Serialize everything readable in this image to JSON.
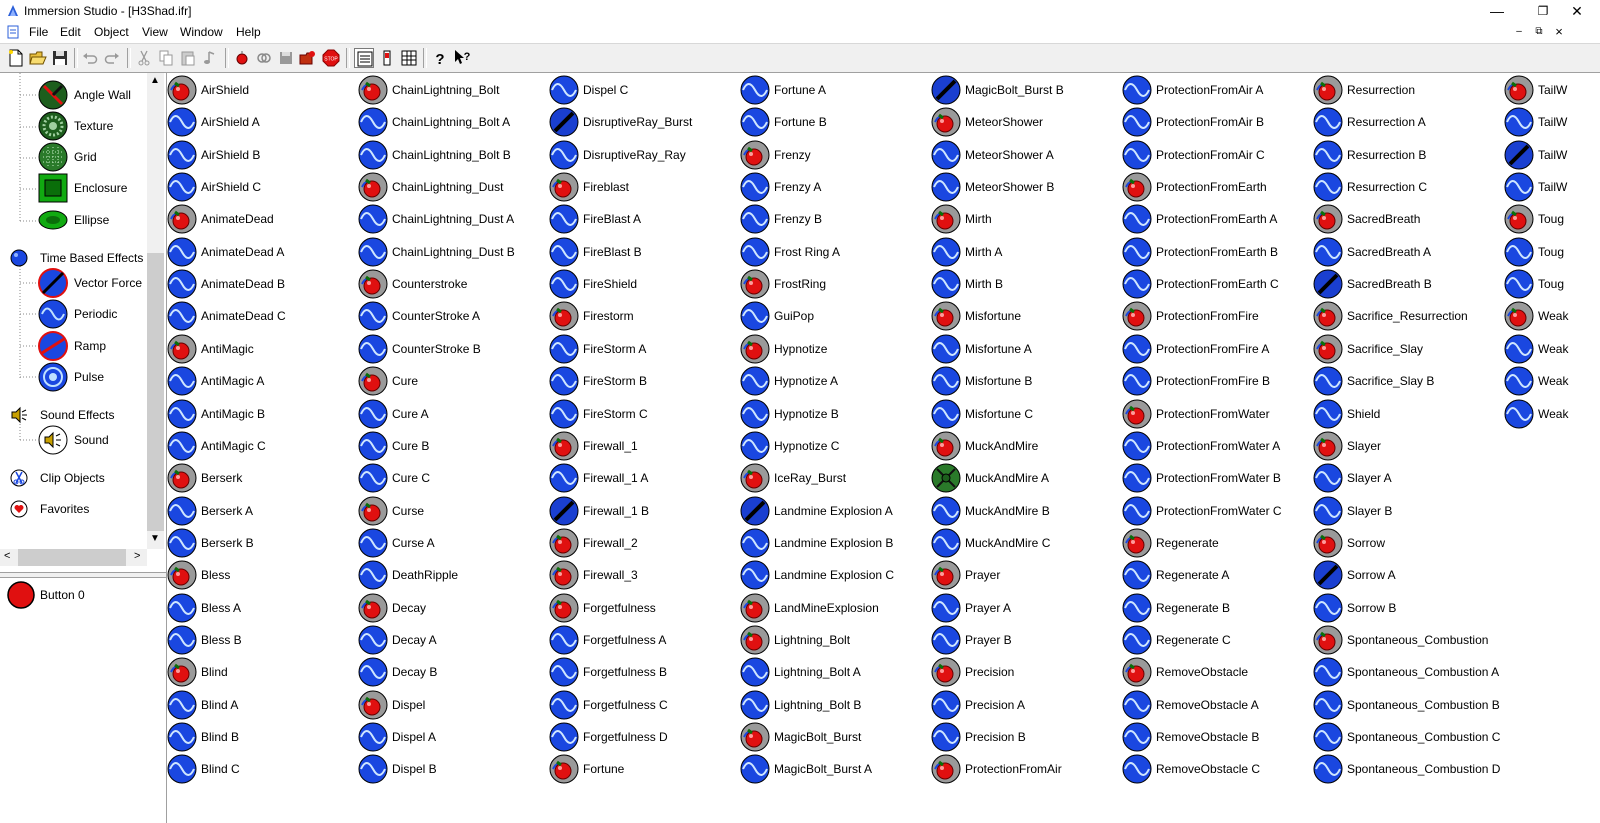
{
  "window": {
    "title": "Immersion Studio - [H3Shad.ifr]",
    "controls": {
      "minimize": "—",
      "restore": "❐",
      "close": "✕"
    }
  },
  "menu": [
    "File",
    "Edit",
    "Object",
    "View",
    "Window",
    "Help"
  ],
  "mdi_controls": {
    "minimize": "–",
    "restore": "⧉",
    "close": "×"
  },
  "toolbar": {
    "buttons": [
      "new",
      "open",
      "save",
      "undo",
      "redo",
      "cut",
      "copy",
      "paste",
      "play-sound",
      "record",
      "link",
      "disk",
      "open-folder",
      "stop",
      "view-list",
      "view-details",
      "view-icons",
      "help",
      "context-help"
    ]
  },
  "tree": {
    "items": [
      {
        "label": "Angle Wall",
        "icon": "angle-wall-icon",
        "indent": true
      },
      {
        "label": "Texture",
        "icon": "texture-icon",
        "indent": true
      },
      {
        "label": "Grid",
        "icon": "grid-icon",
        "indent": true
      },
      {
        "label": "Enclosure",
        "icon": "enclosure-icon",
        "indent": true
      },
      {
        "label": "Ellipse",
        "icon": "ellipse-icon",
        "indent": true
      },
      {
        "label": "Time Based Effects",
        "icon": "blue-ball-icon",
        "indent": false
      },
      {
        "label": "Vector Force",
        "icon": "vector-force-icon",
        "indent": true
      },
      {
        "label": "Periodic",
        "icon": "periodic-icon",
        "indent": true
      },
      {
        "label": "Ramp",
        "icon": "ramp-icon",
        "indent": true
      },
      {
        "label": "Pulse",
        "icon": "pulse-icon",
        "indent": true
      },
      {
        "label": "Sound Effects",
        "icon": "speaker-icon",
        "indent": false
      },
      {
        "label": "Sound",
        "icon": "sound-icon",
        "indent": true
      },
      {
        "label": "Clip Objects",
        "icon": "clip-icon",
        "indent": false
      },
      {
        "label": "Favorites",
        "icon": "heart-icon",
        "indent": false
      }
    ]
  },
  "button_panel": {
    "label": "Button 0"
  },
  "effects": [
    [
      {
        "n": "AirShield",
        "t": "c"
      },
      {
        "n": "AirShield A",
        "t": "p"
      },
      {
        "n": "AirShield B",
        "t": "p"
      },
      {
        "n": "AirShield C",
        "t": "p"
      },
      {
        "n": "AnimateDead",
        "t": "c"
      },
      {
        "n": "AnimateDead A",
        "t": "p"
      },
      {
        "n": "AnimateDead B",
        "t": "p"
      },
      {
        "n": "AnimateDead C",
        "t": "p"
      },
      {
        "n": "AntiMagic",
        "t": "c"
      },
      {
        "n": "AntiMagic A",
        "t": "p"
      },
      {
        "n": "AntiMagic B",
        "t": "p"
      },
      {
        "n": "AntiMagic C",
        "t": "p"
      },
      {
        "n": "Berserk",
        "t": "c"
      },
      {
        "n": "Berserk A",
        "t": "p"
      },
      {
        "n": "Berserk B",
        "t": "p"
      },
      {
        "n": "Bless",
        "t": "c"
      },
      {
        "n": "Bless A",
        "t": "p"
      },
      {
        "n": "Bless B",
        "t": "p"
      },
      {
        "n": "Blind",
        "t": "c"
      },
      {
        "n": "Blind A",
        "t": "p"
      },
      {
        "n": "Blind B",
        "t": "p"
      },
      {
        "n": "Blind C",
        "t": "p"
      }
    ],
    [
      {
        "n": "ChainLightning_Bolt",
        "t": "c"
      },
      {
        "n": "ChainLightning_Bolt A",
        "t": "p"
      },
      {
        "n": "ChainLightning_Bolt B",
        "t": "p"
      },
      {
        "n": "ChainLightning_Dust",
        "t": "c"
      },
      {
        "n": "ChainLightning_Dust A",
        "t": "p"
      },
      {
        "n": "ChainLightning_Dust B",
        "t": "p"
      },
      {
        "n": "Counterstroke",
        "t": "c"
      },
      {
        "n": "CounterStroke A",
        "t": "p"
      },
      {
        "n": "CounterStroke B",
        "t": "p"
      },
      {
        "n": "Cure",
        "t": "c"
      },
      {
        "n": "Cure A",
        "t": "p"
      },
      {
        "n": "Cure B",
        "t": "p"
      },
      {
        "n": "Cure C",
        "t": "p"
      },
      {
        "n": "Curse",
        "t": "c"
      },
      {
        "n": "Curse A",
        "t": "p"
      },
      {
        "n": "DeathRipple",
        "t": "p"
      },
      {
        "n": "Decay",
        "t": "c"
      },
      {
        "n": "Decay A",
        "t": "p"
      },
      {
        "n": "Decay B",
        "t": "p"
      },
      {
        "n": "Dispel",
        "t": "c"
      },
      {
        "n": "Dispel A",
        "t": "p"
      },
      {
        "n": "Dispel B",
        "t": "p"
      }
    ],
    [
      {
        "n": "Dispel C",
        "t": "p"
      },
      {
        "n": "DisruptiveRay_Burst",
        "t": "r"
      },
      {
        "n": "DisruptiveRay_Ray",
        "t": "p"
      },
      {
        "n": "Fireblast",
        "t": "c"
      },
      {
        "n": "FireBlast A",
        "t": "p"
      },
      {
        "n": "FireBlast B",
        "t": "p"
      },
      {
        "n": "FireShield",
        "t": "p"
      },
      {
        "n": "Firestorm",
        "t": "c"
      },
      {
        "n": "FireStorm A",
        "t": "p"
      },
      {
        "n": "FireStorm B",
        "t": "p"
      },
      {
        "n": "FireStorm C",
        "t": "p"
      },
      {
        "n": "Firewall_1",
        "t": "c"
      },
      {
        "n": "Firewall_1 A",
        "t": "p"
      },
      {
        "n": "Firewall_1 B",
        "t": "r"
      },
      {
        "n": "Firewall_2",
        "t": "c"
      },
      {
        "n": "Firewall_3",
        "t": "c"
      },
      {
        "n": "Forgetfulness",
        "t": "c"
      },
      {
        "n": "Forgetfulness A",
        "t": "p"
      },
      {
        "n": "Forgetfulness B",
        "t": "p"
      },
      {
        "n": "Forgetfulness C",
        "t": "p"
      },
      {
        "n": "Forgetfulness D",
        "t": "p"
      },
      {
        "n": "Fortune",
        "t": "c"
      }
    ],
    [
      {
        "n": "Fortune A",
        "t": "p"
      },
      {
        "n": "Fortune B",
        "t": "p"
      },
      {
        "n": "Frenzy",
        "t": "c"
      },
      {
        "n": "Frenzy A",
        "t": "p"
      },
      {
        "n": "Frenzy B",
        "t": "p"
      },
      {
        "n": "Frost Ring A",
        "t": "p"
      },
      {
        "n": "FrostRing",
        "t": "c"
      },
      {
        "n": "GuiPop",
        "t": "p"
      },
      {
        "n": "Hypnotize",
        "t": "c"
      },
      {
        "n": "Hypnotize A",
        "t": "p"
      },
      {
        "n": "Hypnotize B",
        "t": "p"
      },
      {
        "n": "Hypnotize C",
        "t": "p"
      },
      {
        "n": "IceRay_Burst",
        "t": "c"
      },
      {
        "n": "Landmine Explosion A",
        "t": "r"
      },
      {
        "n": "Landmine Explosion B",
        "t": "p"
      },
      {
        "n": "Landmine Explosion C",
        "t": "p"
      },
      {
        "n": "LandMineExplosion",
        "t": "c"
      },
      {
        "n": "Lightning_Bolt",
        "t": "c"
      },
      {
        "n": "Lightning_Bolt A",
        "t": "p"
      },
      {
        "n": "Lightning_Bolt B",
        "t": "p"
      },
      {
        "n": "MagicBolt_Burst",
        "t": "c"
      },
      {
        "n": "MagicBolt_Burst A",
        "t": "p"
      }
    ],
    [
      {
        "n": "MagicBolt_Burst B",
        "t": "r"
      },
      {
        "n": "MeteorShower",
        "t": "c"
      },
      {
        "n": "MeteorShower A",
        "t": "p"
      },
      {
        "n": "MeteorShower B",
        "t": "p"
      },
      {
        "n": "Mirth",
        "t": "c"
      },
      {
        "n": "Mirth A",
        "t": "p"
      },
      {
        "n": "Mirth B",
        "t": "p"
      },
      {
        "n": "Misfortune",
        "t": "c"
      },
      {
        "n": "Misfortune A",
        "t": "p"
      },
      {
        "n": "Misfortune B",
        "t": "p"
      },
      {
        "n": "Misfortune C",
        "t": "p"
      },
      {
        "n": "MuckAndMire",
        "t": "c"
      },
      {
        "n": "MuckAndMire A",
        "t": "g"
      },
      {
        "n": "MuckAndMire B",
        "t": "p"
      },
      {
        "n": "MuckAndMire C",
        "t": "p"
      },
      {
        "n": "Prayer",
        "t": "c"
      },
      {
        "n": "Prayer A",
        "t": "p"
      },
      {
        "n": "Prayer B",
        "t": "p"
      },
      {
        "n": "Precision",
        "t": "c"
      },
      {
        "n": "Precision A",
        "t": "p"
      },
      {
        "n": "Precision B",
        "t": "p"
      },
      {
        "n": "ProtectionFromAir",
        "t": "c"
      }
    ],
    [
      {
        "n": "ProtectionFromAir A",
        "t": "p"
      },
      {
        "n": "ProtectionFromAir B",
        "t": "p"
      },
      {
        "n": "ProtectionFromAir C",
        "t": "p"
      },
      {
        "n": "ProtectionFromEarth",
        "t": "c"
      },
      {
        "n": "ProtectionFromEarth A",
        "t": "p"
      },
      {
        "n": "ProtectionFromEarth B",
        "t": "p"
      },
      {
        "n": "ProtectionFromEarth C",
        "t": "p"
      },
      {
        "n": "ProtectionFromFire",
        "t": "c"
      },
      {
        "n": "ProtectionFromFire A",
        "t": "p"
      },
      {
        "n": "ProtectionFromFire B",
        "t": "p"
      },
      {
        "n": "ProtectionFromWater",
        "t": "c"
      },
      {
        "n": "ProtectionFromWater A",
        "t": "p"
      },
      {
        "n": "ProtectionFromWater B",
        "t": "p"
      },
      {
        "n": "ProtectionFromWater C",
        "t": "p"
      },
      {
        "n": "Regenerate",
        "t": "c"
      },
      {
        "n": "Regenerate A",
        "t": "p"
      },
      {
        "n": "Regenerate B",
        "t": "p"
      },
      {
        "n": "Regenerate C",
        "t": "p"
      },
      {
        "n": "RemoveObstacle",
        "t": "c"
      },
      {
        "n": "RemoveObstacle A",
        "t": "p"
      },
      {
        "n": "RemoveObstacle B",
        "t": "p"
      },
      {
        "n": "RemoveObstacle C",
        "t": "p"
      }
    ],
    [
      {
        "n": "Resurrection",
        "t": "c"
      },
      {
        "n": "Resurrection A",
        "t": "p"
      },
      {
        "n": "Resurrection B",
        "t": "p"
      },
      {
        "n": "Resurrection C",
        "t": "p"
      },
      {
        "n": "SacredBreath",
        "t": "c"
      },
      {
        "n": "SacredBreath A",
        "t": "p"
      },
      {
        "n": "SacredBreath B",
        "t": "r"
      },
      {
        "n": "Sacrifice_Resurrection",
        "t": "c"
      },
      {
        "n": "Sacrifice_Slay",
        "t": "c"
      },
      {
        "n": "Sacrifice_Slay B",
        "t": "p"
      },
      {
        "n": "Shield",
        "t": "p"
      },
      {
        "n": "Slayer",
        "t": "c"
      },
      {
        "n": "Slayer A",
        "t": "p"
      },
      {
        "n": "Slayer B",
        "t": "p"
      },
      {
        "n": "Sorrow",
        "t": "c"
      },
      {
        "n": "Sorrow A",
        "t": "r"
      },
      {
        "n": "Sorrow B",
        "t": "p"
      },
      {
        "n": "Spontaneous_Combustion",
        "t": "c"
      },
      {
        "n": "Spontaneous_Combustion A",
        "t": "p"
      },
      {
        "n": "Spontaneous_Combustion B",
        "t": "p"
      },
      {
        "n": "Spontaneous_Combustion C",
        "t": "p"
      },
      {
        "n": "Spontaneous_Combustion D",
        "t": "p"
      }
    ],
    [
      {
        "n": "TailW",
        "t": "c"
      },
      {
        "n": "TailW",
        "t": "p"
      },
      {
        "n": "TailW",
        "t": "r"
      },
      {
        "n": "TailW",
        "t": "p"
      },
      {
        "n": "Toug",
        "t": "c"
      },
      {
        "n": "Toug",
        "t": "p"
      },
      {
        "n": "Toug",
        "t": "p"
      },
      {
        "n": "Weak",
        "t": "c"
      },
      {
        "n": "Weak",
        "t": "p"
      },
      {
        "n": "Weak",
        "t": "p"
      },
      {
        "n": "Weak",
        "t": "p"
      }
    ]
  ],
  "colors": {
    "periodic_blue": "#1a47e0",
    "compound_red": "#e01010",
    "ramp_blue": "#1a3fd0",
    "grid_green": "#2a7a2a"
  }
}
